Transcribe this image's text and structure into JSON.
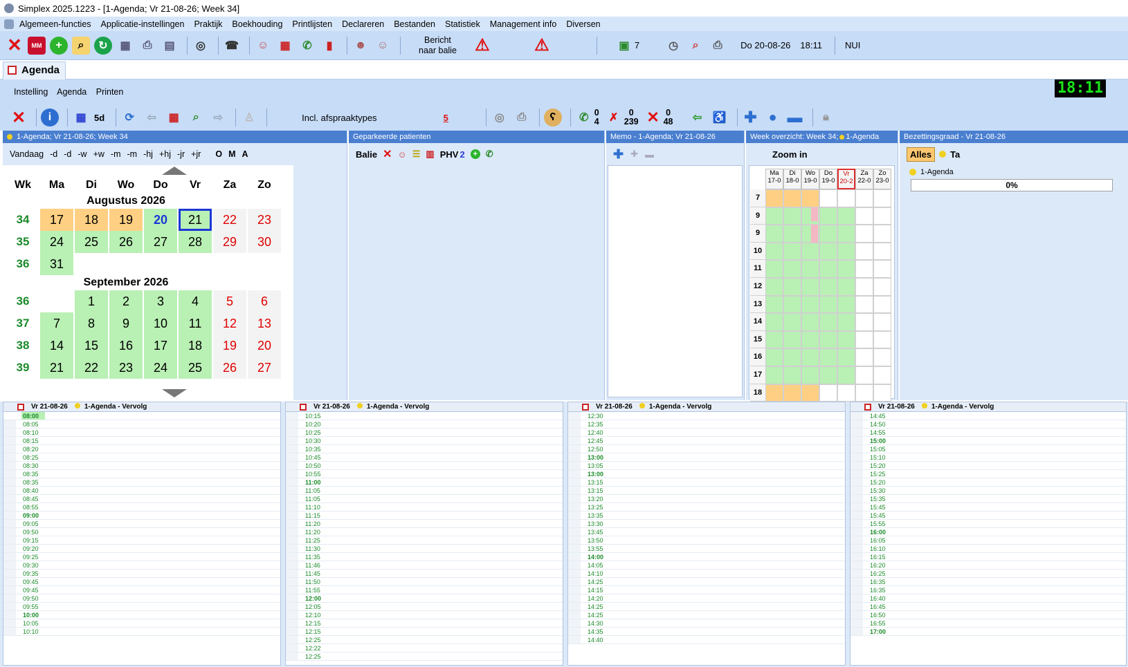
{
  "app": {
    "title": "Simplex 2025.1223 - [1-Agenda; Vr 21-08-26; Week 34]"
  },
  "menu": [
    "Algemeen-functies",
    "Applicatie-instellingen",
    "Praktijk",
    "Boekhouding",
    "Printlijsten",
    "Declareren",
    "Bestanden",
    "Statistiek",
    "Management info",
    "Diversen"
  ],
  "toolbar": {
    "bericht_line1": "Bericht",
    "bericht_line2": "naar balie",
    "messages_count": "7",
    "date": "Do 20-08-26",
    "time": "18:11",
    "caps": "NUI",
    "mm_label": "MM"
  },
  "tab": {
    "label": "Agenda"
  },
  "submenu": [
    "Instelling",
    "Agenda",
    "Printen"
  ],
  "clock": "18:11",
  "toolbar2": {
    "fiveday": "5d",
    "afspraak_label": "Incl. afspraaktypes",
    "afspraak_count": "5",
    "c1a": "0",
    "c1b": "4",
    "c2a": "0",
    "c2b": "239",
    "c3a": "0",
    "c3b": "48"
  },
  "calendar": {
    "header": "1-Agenda; Vr 21-08-26; Week 34",
    "nav": [
      "Vandaag",
      "-d",
      "-d",
      "-w",
      "+w",
      "-m",
      "-m",
      "-hj",
      "+hj",
      "-jr",
      "+jr"
    ],
    "oma": [
      "O",
      "M",
      "A"
    ],
    "days": [
      "Wk",
      "Ma",
      "Di",
      "Wo",
      "Do",
      "Vr",
      "Za",
      "Zo"
    ],
    "month1": "Augustus 2026",
    "month2": "September 2026"
  },
  "parked": {
    "header": "Geparkeerde patienten",
    "balie": "Balie",
    "phv": "PHV",
    "phv_num": "2"
  },
  "memo": {
    "header": "Memo - 1-Agenda; Vr 21-08-26"
  },
  "week": {
    "header": "Week overzicht: Week 34;",
    "agenda": "1-Agenda",
    "zoom": "Zoom in",
    "days": [
      [
        "Ma",
        "17-0"
      ],
      [
        "Di",
        "18-0"
      ],
      [
        "Wo",
        "19-0"
      ],
      [
        "Do",
        "19-0"
      ],
      [
        "Vr",
        "20-2"
      ],
      [
        "Za",
        "22-0"
      ],
      [
        "Zo",
        "23-0"
      ]
    ],
    "hours": [
      "7",
      "9",
      "9",
      "10",
      "11",
      "12",
      "13",
      "14",
      "15",
      "16",
      "17",
      "18"
    ]
  },
  "occupancy": {
    "header": "Bezettingsgraad - Vr 21-08-26",
    "alles": "Alles",
    "ta": "Ta",
    "agenda": "1-Agenda",
    "percent": "0%"
  },
  "daycols": [
    {
      "date": "Vr 21-08-26",
      "agenda": "1-Agenda - Vervolg",
      "times": [
        "08:00",
        "08:05",
        "08:10",
        "08:15",
        "08:20",
        "08:25",
        "08:30",
        "08:35",
        "08:35",
        "08:40",
        "08:45",
        "08:55",
        "09:00",
        "09:05",
        "09:50",
        "09:15",
        "09:20",
        "09:25",
        "09:30",
        "09:35",
        "09:45",
        "09:45",
        "09:50",
        "09:55",
        "10:00",
        "10:05",
        "10:10"
      ]
    },
    {
      "date": "Vr 21-08-26",
      "agenda": "1-Agenda - Vervolg",
      "times": [
        "10:15",
        "10:20",
        "10:25",
        "10:30",
        "10:35",
        "10:45",
        "10:50",
        "10:55",
        "11:00",
        "11:05",
        "11:05",
        "11:10",
        "11:15",
        "11:20",
        "11:20",
        "11:25",
        "11:30",
        "11:35",
        "11:46",
        "11:45",
        "11:50",
        "11:55",
        "12:00",
        "12:05",
        "12:10",
        "12:15",
        "12:15",
        "12:25",
        "12:22",
        "12:25"
      ]
    },
    {
      "date": "Vr 21-08-26",
      "agenda": "1-Agenda - Vervolg",
      "times": [
        "12:30",
        "12:35",
        "12:40",
        "12:45",
        "12:50",
        "13:00",
        "13:05",
        "13:00",
        "13:15",
        "13:15",
        "13:20",
        "13:25",
        "13:35",
        "13:30",
        "13:45",
        "13:50",
        "13:55",
        "14:00",
        "14:05",
        "14:10",
        "14:25",
        "14:15",
        "14:20",
        "14:25",
        "14:25",
        "14:30",
        "14:35",
        "14:40"
      ]
    },
    {
      "date": "Vr 21-08-26",
      "agenda": "1-Agenda - Vervolg",
      "times": [
        "14:45",
        "14:50",
        "14:55",
        "15:00",
        "15:05",
        "15:10",
        "15:20",
        "15:25",
        "15:20",
        "15:30",
        "15:35",
        "15:45",
        "15:45",
        "15:55",
        "16:00",
        "16:05",
        "16:10",
        "16:15",
        "16:20",
        "16:25",
        "16:35",
        "16:35",
        "16:40",
        "16:45",
        "16:50",
        "16:55",
        "17:00"
      ]
    }
  ]
}
